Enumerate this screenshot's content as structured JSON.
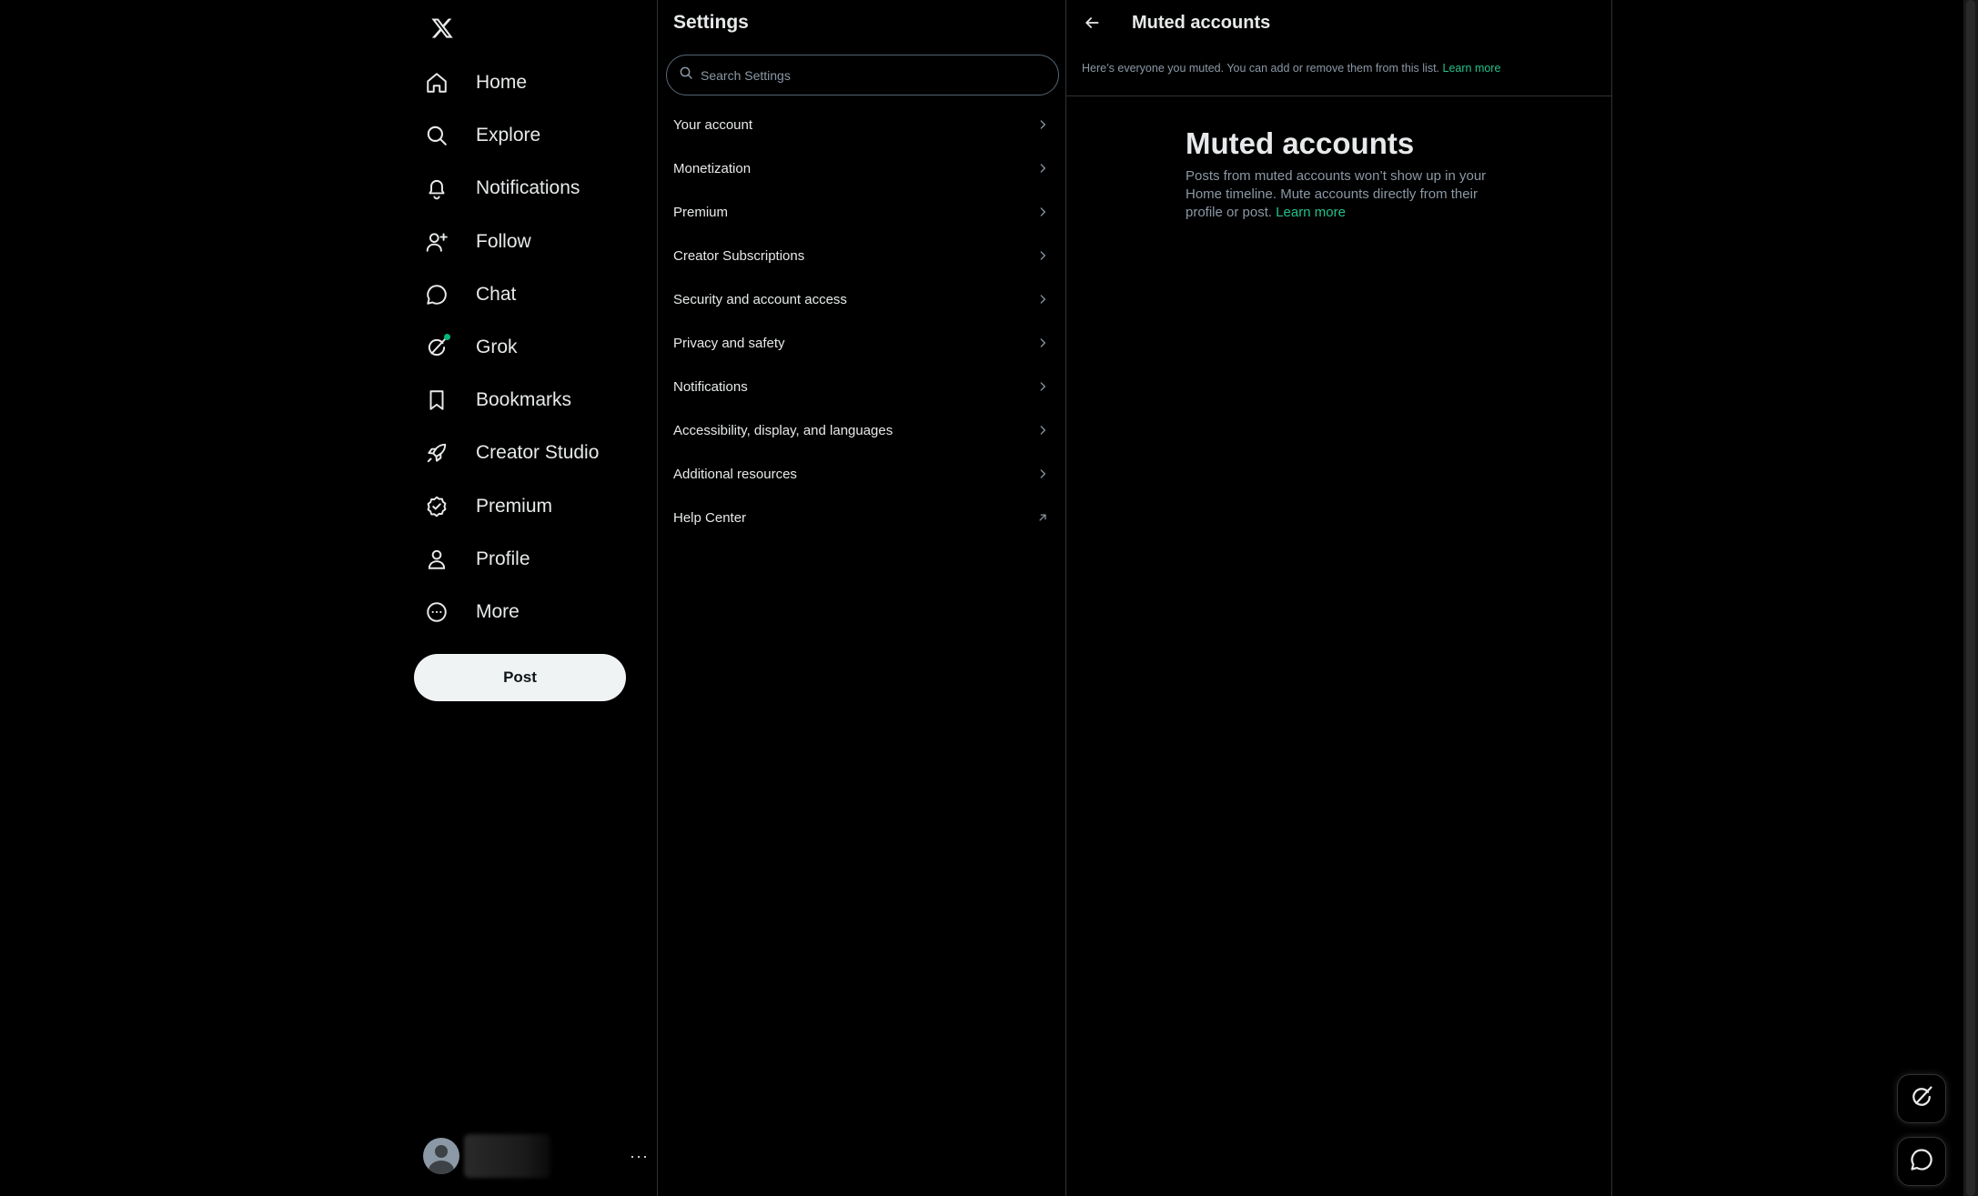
{
  "nav": {
    "logo_icon": "x-logo-icon",
    "items": [
      {
        "label": "Home",
        "icon": "home-icon"
      },
      {
        "label": "Explore",
        "icon": "search-icon"
      },
      {
        "label": "Notifications",
        "icon": "bell-icon"
      },
      {
        "label": "Follow",
        "icon": "person-add-icon"
      },
      {
        "label": "Chat",
        "icon": "chat-bubble-icon"
      },
      {
        "label": "Grok",
        "icon": "grok-icon"
      },
      {
        "label": "Bookmarks",
        "icon": "bookmark-icon"
      },
      {
        "label": "Creator Studio",
        "icon": "rocket-icon"
      },
      {
        "label": "Premium",
        "icon": "verified-badge-icon"
      },
      {
        "label": "Profile",
        "icon": "person-icon"
      },
      {
        "label": "More",
        "icon": "more-circle-icon"
      }
    ],
    "post_label": "Post",
    "account_more": "···"
  },
  "settings": {
    "title": "Settings",
    "search_placeholder": "Search Settings",
    "items": [
      {
        "label": "Your account",
        "icon": "chevron-right-icon"
      },
      {
        "label": "Monetization",
        "icon": "chevron-right-icon"
      },
      {
        "label": "Premium",
        "icon": "chevron-right-icon"
      },
      {
        "label": "Creator Subscriptions",
        "icon": "chevron-right-icon"
      },
      {
        "label": "Security and account access",
        "icon": "chevron-right-icon"
      },
      {
        "label": "Privacy and safety",
        "icon": "chevron-right-icon"
      },
      {
        "label": "Notifications",
        "icon": "chevron-right-icon"
      },
      {
        "label": "Accessibility, display, and languages",
        "icon": "chevron-right-icon"
      },
      {
        "label": "Additional resources",
        "icon": "chevron-right-icon"
      },
      {
        "label": "Help Center",
        "icon": "external-link-icon"
      }
    ]
  },
  "detail": {
    "title": "Muted accounts",
    "description": "Here’s everyone you muted. You can add or remove them from this list. ",
    "description_link": "Learn more",
    "empty_title": "Muted accounts",
    "empty_body": "Posts from muted accounts won’t show up in your Home timeline. Mute accounts directly from their profile or post. ",
    "empty_link": "Learn more"
  },
  "colors": {
    "background": "#000000",
    "text_primary": "#e7e9ea",
    "text_secondary": "#8b98a5",
    "border": "#2f3336",
    "accent_link": "#22c08a",
    "notification_dot": "#00ba7c"
  }
}
